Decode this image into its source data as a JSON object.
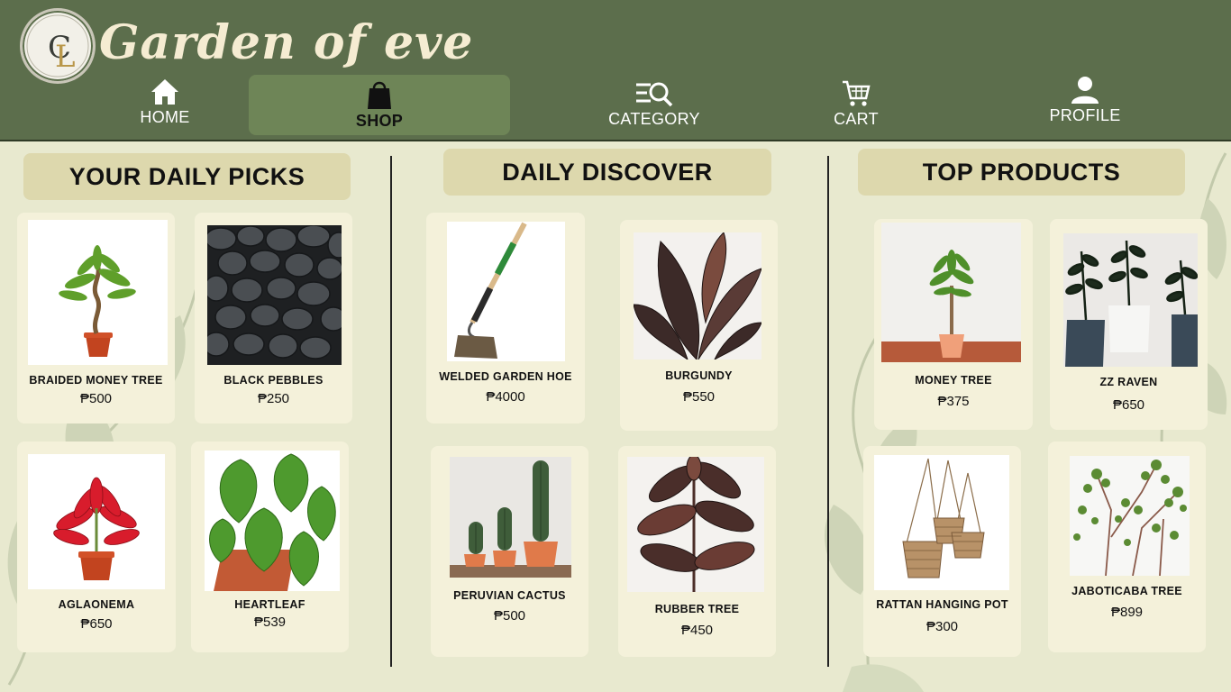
{
  "brand": {
    "title": "Garden of eve",
    "logo_text": "GARDEN OF EVE",
    "monogram": "GE"
  },
  "nav": {
    "home": "HOME",
    "shop": "SHOP",
    "category": "CATEGORY",
    "cart": "CART",
    "profile": "PROFILE",
    "active": "SHOP"
  },
  "sections": {
    "daily_picks": {
      "title": "YOUR DAILY PICKS",
      "items": [
        {
          "name": "BRAIDED MONEY TREE",
          "price": "₱500"
        },
        {
          "name": "BLACK PEBBLES",
          "price": "₱250"
        },
        {
          "name": "AGLAONEMA",
          "price": "₱650"
        },
        {
          "name": "HEARTLEAF",
          "price": "₱539"
        }
      ]
    },
    "daily_discover": {
      "title": "DAILY DISCOVER",
      "items": [
        {
          "name": "WELDED GARDEN HOE",
          "price": "₱4000"
        },
        {
          "name": "BURGUNDY",
          "price": "₱550"
        },
        {
          "name": "PERUVIAN CACTUS",
          "price": "₱500"
        },
        {
          "name": "RUBBER TREE",
          "price": "₱450"
        }
      ]
    },
    "top_products": {
      "title": "TOP PRODUCTS",
      "items": [
        {
          "name": "MONEY TREE",
          "price": "₱375"
        },
        {
          "name": "ZZ RAVEN",
          "price": "₱650"
        },
        {
          "name": "RATTAN HANGING POT",
          "price": "₱300"
        },
        {
          "name": "JABOTICABA TREE",
          "price": "₱899"
        }
      ]
    }
  },
  "colors": {
    "header": "#5c6e4c",
    "nav_active": "#6e8557",
    "page_bg": "#e8e9cf",
    "section_header": "#ddd8ad",
    "card": "#f4f1da"
  }
}
